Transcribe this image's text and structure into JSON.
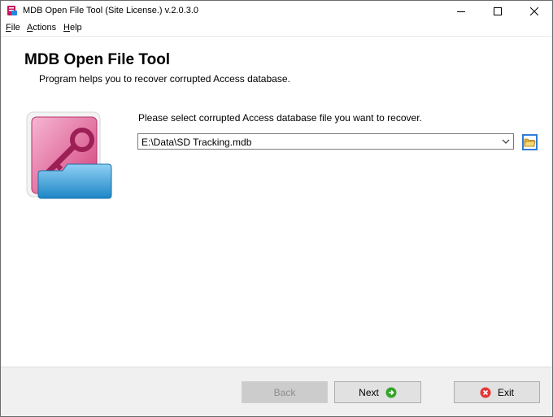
{
  "window": {
    "title": "MDB Open File Tool (Site License.) v.2.0.3.0"
  },
  "menu": {
    "file_label": "File",
    "file_hotkey": "F",
    "file_rest": "ile",
    "actions_label": "Actions",
    "actions_hotkey": "A",
    "actions_rest": "ctions",
    "help_label": "Help",
    "help_hotkey": "H",
    "help_rest": "elp"
  },
  "header": {
    "title": "MDB Open File Tool",
    "subtitle": "Program helps you to recover corrupted Access database."
  },
  "main": {
    "prompt": "Please select corrupted Access database file you want to recover.",
    "file_path": "E:\\Data\\SD Tracking.mdb"
  },
  "footer": {
    "back_label": "Back",
    "next_label": "Next",
    "exit_label": "Exit"
  },
  "colors": {
    "accent_blue": "#2f7cd8",
    "next_icon": "#33a52a",
    "exit_icon": "#e53535"
  },
  "icons": {
    "app": "mdb-app-icon",
    "hero": "access-key-folder-icon",
    "browse": "open-folder-icon",
    "next": "green-arrow-right-icon",
    "exit": "red-x-icon"
  }
}
